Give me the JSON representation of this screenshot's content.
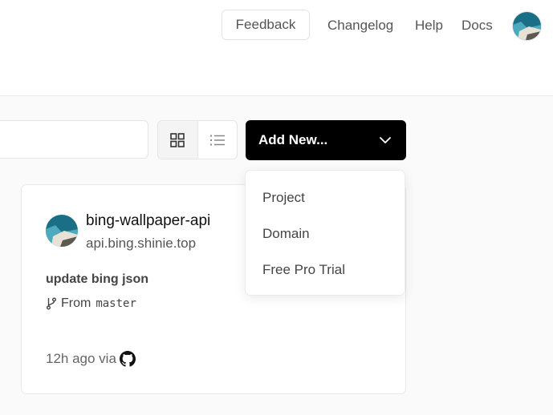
{
  "header": {
    "feedback_label": "Feedback",
    "nav": [
      "Changelog",
      "Help",
      "Docs"
    ]
  },
  "toolbar": {
    "add_new_label": "Add New...",
    "dropdown_items": [
      "Project",
      "Domain",
      "Free Pro Trial"
    ]
  },
  "project": {
    "name": "bing-wallpaper-api",
    "domain": "api.bing.shinie.top",
    "commit_message": "update bing json",
    "branch_prefix": "From",
    "branch": "master",
    "time": "12h ago via",
    "source_icon": "github-icon"
  },
  "colors": {
    "primary_button": "#000000",
    "background": "#fafafa",
    "border": "#e5e5e5"
  }
}
